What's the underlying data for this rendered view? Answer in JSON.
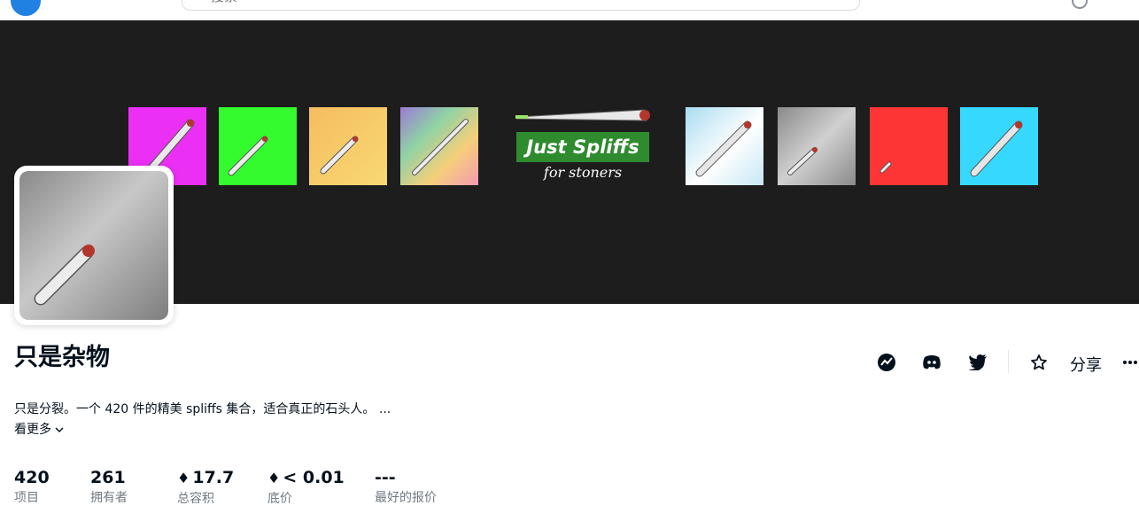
{
  "header": {
    "search_placeholder": "搜索"
  },
  "banner": {
    "tiles": [
      "#ec2ff5",
      "#34fb2e",
      "#f4c75a",
      "#a78fd4",
      "#dff1f8",
      "#9a9a9a",
      "#fe3535",
      "#36d8fe"
    ],
    "brand": "Just Spliffs",
    "brand_sub": "for stoners"
  },
  "collection": {
    "title": "只是杂物",
    "description": "只是分裂。一个 420 件的精美 spliffs 集合，适合真正的石头人。 ...",
    "see_more": "看更多",
    "share_label": "分享"
  },
  "stats": [
    {
      "value": "420",
      "label": "项目"
    },
    {
      "value": "261",
      "label": "拥有者"
    },
    {
      "value": "17.7",
      "label": "总容积",
      "eth": "♦"
    },
    {
      "value": "< 0.01",
      "label": "底价",
      "eth": "♦"
    },
    {
      "value": "---",
      "label": "最好的报价"
    }
  ],
  "colors": {
    "accent": "#2081e2",
    "banner_bg": "#1d1d1d",
    "brand_green": "#2e8b2e"
  }
}
